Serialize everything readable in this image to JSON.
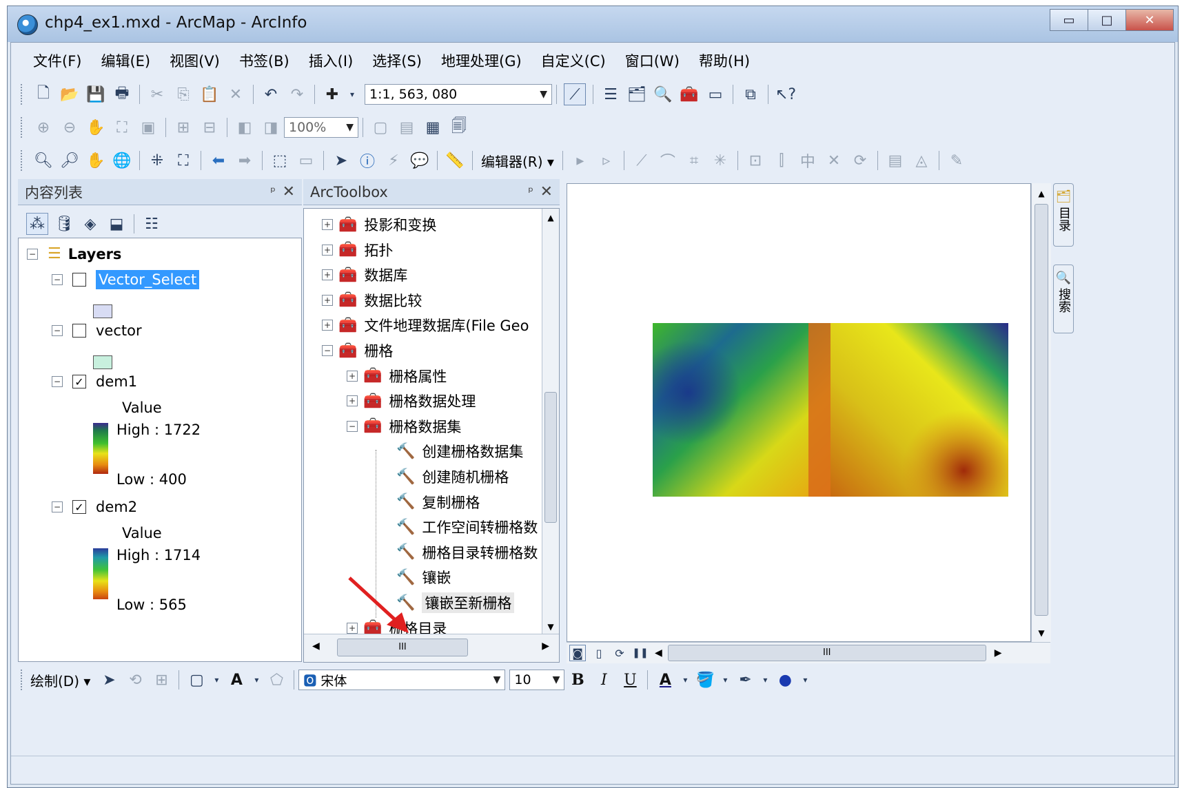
{
  "window": {
    "title": "chp4_ex1.mxd - ArcMap - ArcInfo",
    "minimize": "▭",
    "maximize": "□",
    "close": "✕"
  },
  "menu": [
    "文件(F)",
    "编辑(E)",
    "视图(V)",
    "书签(B)",
    "插入(I)",
    "选择(S)",
    "地理处理(G)",
    "自定义(C)",
    "窗口(W)",
    "帮助(H)"
  ],
  "standard_toolbar": {
    "scale": "1:1, 563, 080"
  },
  "layout_toolbar": {
    "zoom": "100%"
  },
  "editor_toolbar": {
    "editor_label": "编辑器(R) ▾"
  },
  "toc": {
    "header": "内容列表",
    "root": "Layers",
    "layers": [
      {
        "name": "Vector_Select",
        "checked": false,
        "selected": true,
        "swatch": "#d8dcf4"
      },
      {
        "name": "vector",
        "checked": false,
        "selected": false,
        "swatch": "#c8f0de"
      },
      {
        "name": "dem1",
        "checked": true,
        "value_label": "Value",
        "high": "High : 1722",
        "low": "Low : 400"
      },
      {
        "name": "dem2",
        "checked": true,
        "value_label": "Value",
        "high": "High : 1714",
        "low": "Low : 565"
      }
    ]
  },
  "toolbox": {
    "header": "ArcToolbox",
    "items": [
      {
        "label": "投影和变换",
        "level": 0,
        "kind": "toolset",
        "exp": "+"
      },
      {
        "label": "拓扑",
        "level": 0,
        "kind": "toolset",
        "exp": "+"
      },
      {
        "label": "数据库",
        "level": 0,
        "kind": "toolset",
        "exp": "+"
      },
      {
        "label": "数据比较",
        "level": 0,
        "kind": "toolset",
        "exp": "+"
      },
      {
        "label": "文件地理数据库(File Geo",
        "level": 0,
        "kind": "toolset",
        "exp": "+"
      },
      {
        "label": "栅格",
        "level": 0,
        "kind": "toolset",
        "exp": "−"
      },
      {
        "label": "栅格属性",
        "level": 1,
        "kind": "toolset",
        "exp": "+"
      },
      {
        "label": "栅格数据处理",
        "level": 1,
        "kind": "toolset",
        "exp": "+"
      },
      {
        "label": "栅格数据集",
        "level": 1,
        "kind": "toolset",
        "exp": "−"
      },
      {
        "label": "创建栅格数据集",
        "level": 2,
        "kind": "tool"
      },
      {
        "label": "创建随机栅格",
        "level": 2,
        "kind": "tool"
      },
      {
        "label": "复制栅格",
        "level": 2,
        "kind": "tool"
      },
      {
        "label": "工作空间转栅格数",
        "level": 2,
        "kind": "tool"
      },
      {
        "label": "栅格目录转栅格数",
        "level": 2,
        "kind": "tool"
      },
      {
        "label": "镶嵌",
        "level": 2,
        "kind": "tool"
      },
      {
        "label": "镶嵌至新栅格",
        "level": 2,
        "kind": "tool",
        "highlight": true
      },
      {
        "label": "栅格目录",
        "level": 1,
        "kind": "toolset",
        "exp": "+"
      }
    ],
    "hscroll_label": "III"
  },
  "side_tabs": [
    "目录",
    "搜索"
  ],
  "draw_toolbar": {
    "draw_label": "绘制(D) ▾",
    "font": "宋体",
    "size": "10",
    "bold": "B",
    "italic": "I",
    "underline": "U",
    "font_color": "A"
  },
  "map_hscroll_label": "III"
}
